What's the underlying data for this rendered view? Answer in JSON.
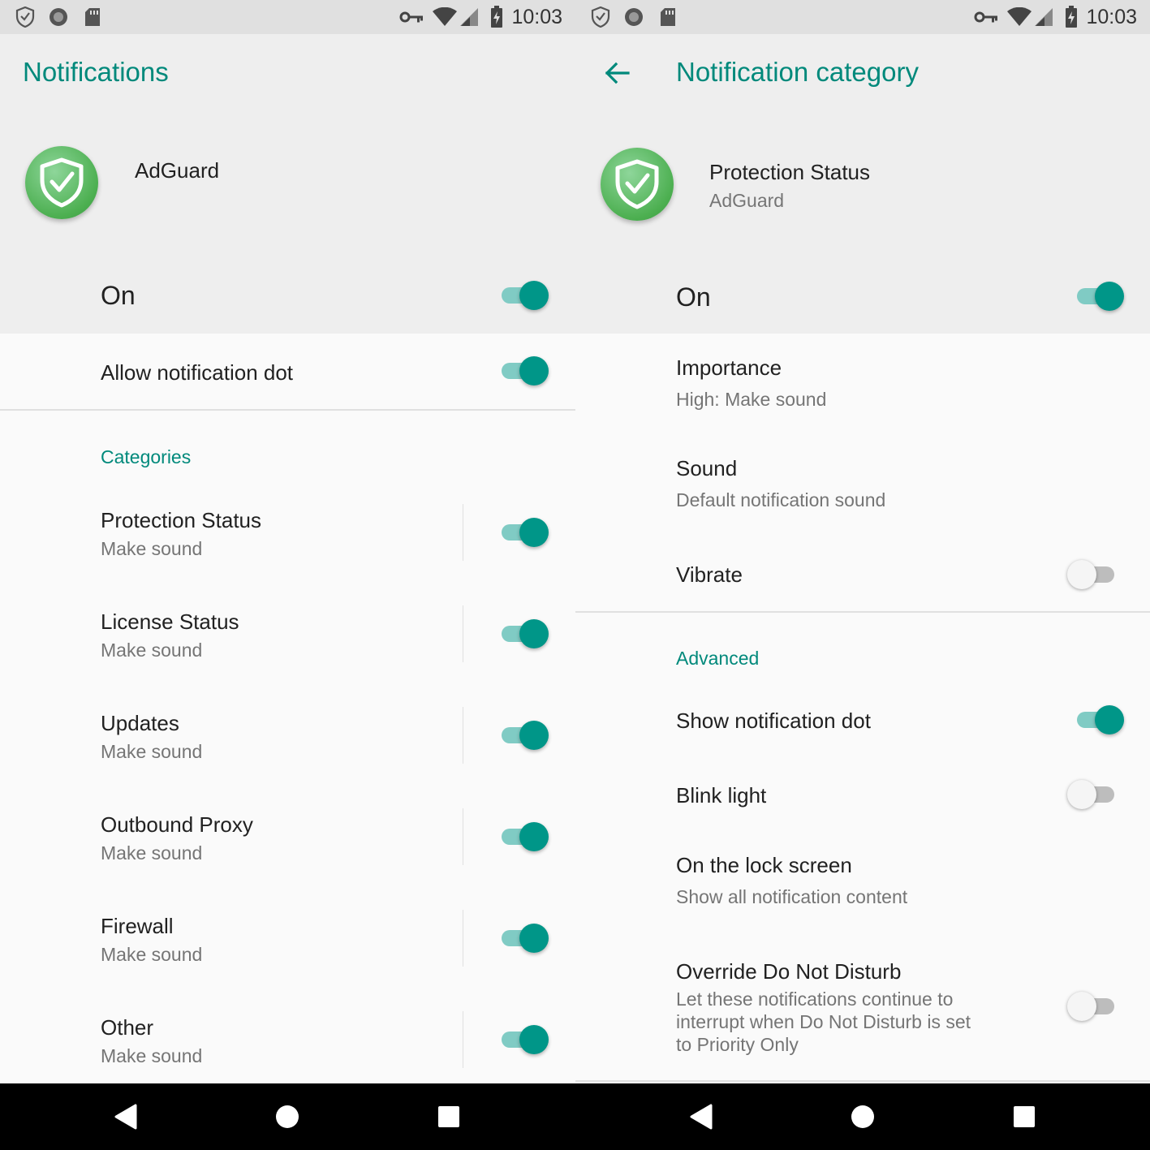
{
  "status_bar": {
    "time": "10:03"
  },
  "left": {
    "title": "Notifications",
    "app_name": "AdGuard",
    "master_label": "On",
    "master_on": true,
    "dot_label": "Allow notification dot",
    "dot_on": true,
    "section_header": "Categories",
    "categories": [
      {
        "label": "Protection Status",
        "summary": "Make sound",
        "on": true
      },
      {
        "label": "License Status",
        "summary": "Make sound",
        "on": true
      },
      {
        "label": "Updates",
        "summary": "Make sound",
        "on": true
      },
      {
        "label": "Outbound Proxy",
        "summary": "Make sound",
        "on": true
      },
      {
        "label": "Firewall",
        "summary": "Make sound",
        "on": true
      },
      {
        "label": "Other",
        "summary": "Make sound",
        "on": true
      }
    ]
  },
  "right": {
    "title": "Notification category",
    "category_name": "Protection Status",
    "app_name": "AdGuard",
    "master_label": "On",
    "master_on": true,
    "importance": {
      "label": "Importance",
      "summary": "High: Make sound"
    },
    "sound": {
      "label": "Sound",
      "summary": "Default notification sound"
    },
    "vibrate": {
      "label": "Vibrate",
      "on": false
    },
    "section_header": "Advanced",
    "show_dot": {
      "label": "Show notification dot",
      "on": true
    },
    "blink": {
      "label": "Blink light",
      "on": false
    },
    "lock_screen": {
      "label": "On the lock screen",
      "summary": "Show all notification content"
    },
    "dnd": {
      "label": "Override Do Not Disturb",
      "summary_lines": [
        "Let these notifications continue to",
        "interrupt when Do Not Disturb is set",
        "to Priority Only"
      ],
      "on": false
    }
  },
  "icons": [
    "shield-icon",
    "circle-icon",
    "sd-card-icon",
    "vpn-key-icon",
    "wifi-icon",
    "cell-signal-icon",
    "battery-charging-icon",
    "back-arrow-icon",
    "adguard-logo-icon",
    "nav-back-icon",
    "nav-home-icon",
    "nav-recents-icon"
  ],
  "colors": {
    "accent": "#009688",
    "title": "#00897b",
    "track_on": "#80cbc4"
  }
}
